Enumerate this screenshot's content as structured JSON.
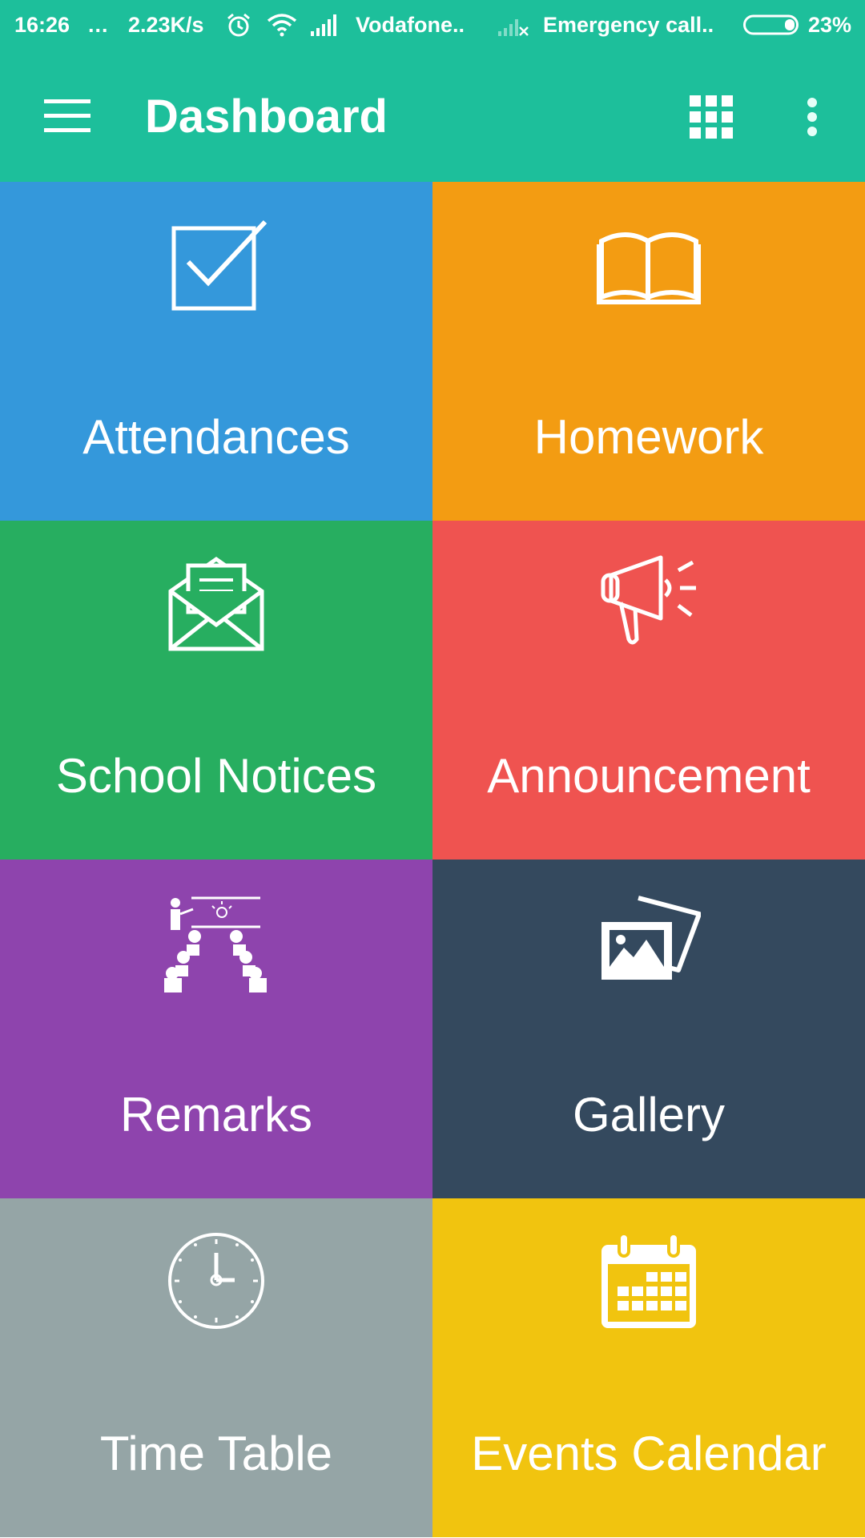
{
  "status_bar": {
    "time": "16:26",
    "dots": "...",
    "network_speed": "2.23K/s",
    "carrier": "Vodafone..",
    "emergency": "Emergency call..",
    "battery": "23%",
    "icons": [
      "alarm-icon",
      "wifi-icon",
      "signal-icon",
      "signal-off-icon",
      "battery-icon"
    ]
  },
  "header": {
    "title": "Dashboard",
    "color": "#1dbf9b",
    "icons": [
      "menu-icon",
      "grid-icon",
      "more-vert-icon"
    ]
  },
  "tiles": [
    {
      "label": "Attendances",
      "icon": "checkbox-icon",
      "color": "#3498db"
    },
    {
      "label": "Homework",
      "icon": "book-icon",
      "color": "#f39c12"
    },
    {
      "label": "School Notices",
      "icon": "mail-icon",
      "color": "#27ae60"
    },
    {
      "label": "Announcement",
      "icon": "megaphone-icon",
      "color": "#ef5350"
    },
    {
      "label": "Remarks",
      "icon": "classroom-icon",
      "color": "#8e44ad"
    },
    {
      "label": "Gallery",
      "icon": "photos-icon",
      "color": "#34495e"
    },
    {
      "label": "Time Table",
      "icon": "clock-icon",
      "color": "#95a5a6"
    },
    {
      "label": "Events Calendar",
      "icon": "calendar-icon",
      "color": "#f1c40f"
    }
  ]
}
